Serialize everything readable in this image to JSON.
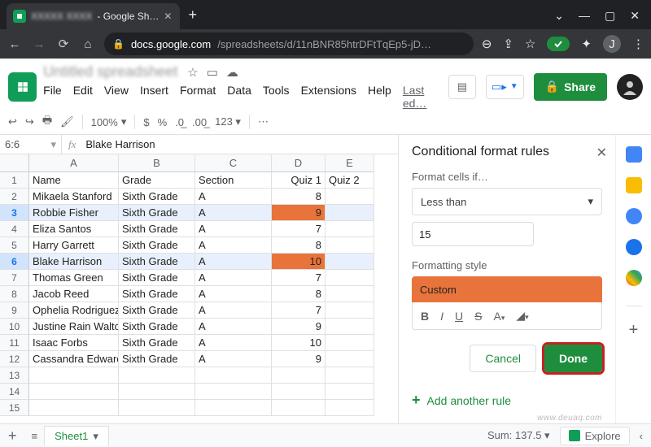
{
  "browser": {
    "tab_title_suffix": " - Google Sh…",
    "url_host": "docs.google.com",
    "url_path": "/spreadsheets/d/11nBNR85htrDFtTqEp5-jD…",
    "avatar_letter": "J"
  },
  "doc": {
    "title": "Untitled spreadsheet",
    "menus": [
      "File",
      "Edit",
      "View",
      "Insert",
      "Format",
      "Data",
      "Tools",
      "Extensions",
      "Help"
    ],
    "last_edit": "Last ed…",
    "share": "Share"
  },
  "toolbar": {
    "zoom": "100%",
    "numfmt": "123",
    "currency": "$",
    "percent": "%"
  },
  "namebox": "6:6",
  "formula": "Blake Harrison",
  "columns": [
    "A",
    "B",
    "C",
    "D",
    "E"
  ],
  "headers": [
    "Name",
    "Grade",
    "Section",
    "Quiz 1",
    "Quiz 2"
  ],
  "rows": [
    {
      "n": 2,
      "a": "Mikaela Stanford",
      "b": "Sixth Grade",
      "c": "A",
      "d": "8"
    },
    {
      "n": 3,
      "a": "Robbie Fisher",
      "b": "Sixth Grade",
      "c": "A",
      "d": "9",
      "sel": true,
      "hl": true
    },
    {
      "n": 4,
      "a": "Eliza Santos",
      "b": "Sixth Grade",
      "c": "A",
      "d": "7"
    },
    {
      "n": 5,
      "a": "Harry Garrett",
      "b": "Sixth Grade",
      "c": "A",
      "d": "8"
    },
    {
      "n": 6,
      "a": "Blake Harrison",
      "b": "Sixth Grade",
      "c": "A",
      "d": "10",
      "sel": true,
      "hl": true
    },
    {
      "n": 7,
      "a": "Thomas Green",
      "b": "Sixth Grade",
      "c": "A",
      "d": "7"
    },
    {
      "n": 8,
      "a": "Jacob Reed",
      "b": "Sixth Grade",
      "c": "A",
      "d": "8"
    },
    {
      "n": 9,
      "a": "Ophelia Rodriguez",
      "b": "Sixth Grade",
      "c": "A",
      "d": "7"
    },
    {
      "n": 10,
      "a": "Justine Rain Walton",
      "b": "Sixth Grade",
      "c": "A",
      "d": "9"
    },
    {
      "n": 11,
      "a": "Isaac Forbs",
      "b": "Sixth Grade",
      "c": "A",
      "d": "10"
    },
    {
      "n": 12,
      "a": "Cassandra Edwards",
      "b": "Sixth Grade",
      "c": "A",
      "d": "9"
    },
    {
      "n": 13,
      "a": "",
      "b": "",
      "c": "",
      "d": ""
    },
    {
      "n": 14,
      "a": "",
      "b": "",
      "c": "",
      "d": ""
    },
    {
      "n": 15,
      "a": "",
      "b": "",
      "c": "",
      "d": ""
    }
  ],
  "panel": {
    "title": "Conditional format rules",
    "label1": "Format cells if…",
    "condition": "Less than",
    "value": "15",
    "label2": "Formatting style",
    "style_name": "Custom",
    "cancel": "Cancel",
    "done": "Done",
    "add": "Add another rule"
  },
  "footer": {
    "sheet": "Sheet1",
    "sum": "Sum: 137.5",
    "explore": "Explore"
  },
  "watermark": "www.deuaq.com"
}
